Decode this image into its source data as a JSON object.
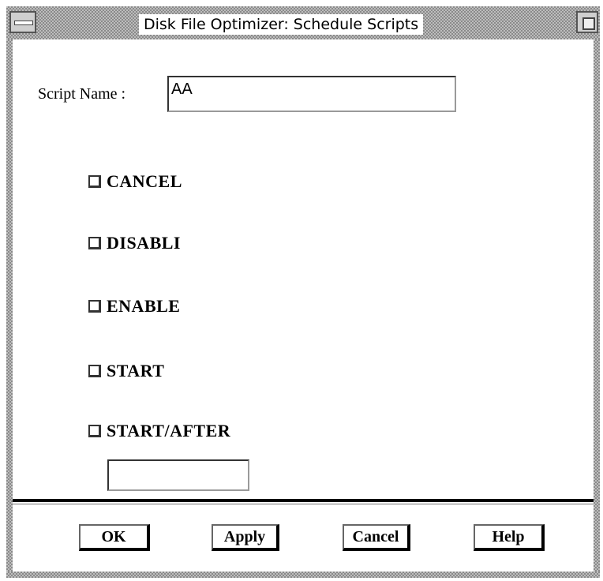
{
  "window": {
    "title": "Disk File Optimizer: Schedule Scripts"
  },
  "form": {
    "script_name_label": "Script Name :",
    "script_name_value": "AA",
    "after_value": ""
  },
  "options": [
    {
      "label": "CANCEL",
      "checked": false
    },
    {
      "label": "DISABLI",
      "checked": false
    },
    {
      "label": "ENABLE",
      "checked": false
    },
    {
      "label": "START",
      "checked": false
    },
    {
      "label": "START/AFTER",
      "checked": false
    }
  ],
  "buttons": {
    "ok": "OK",
    "apply": "Apply",
    "cancel": "Cancel",
    "help": "Help"
  },
  "icons": {
    "window_menu": "window-menu-icon",
    "maximize": "maximize-icon"
  }
}
